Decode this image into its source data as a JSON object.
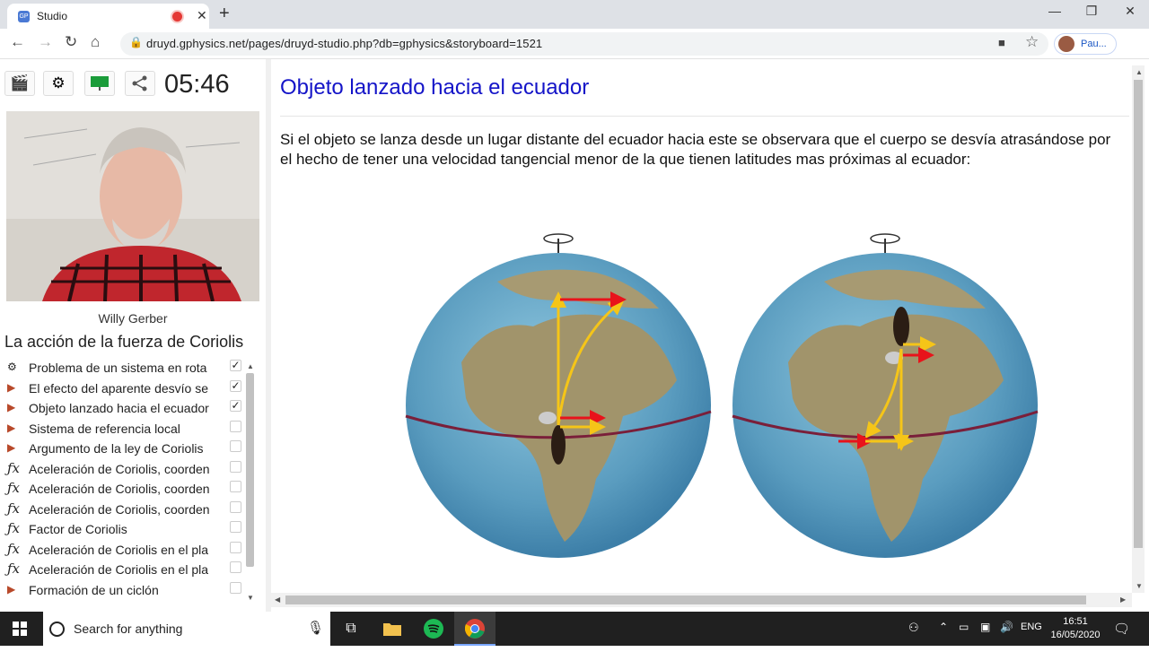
{
  "browser": {
    "tab_title": "Studio",
    "url": "druyd.gphysics.net/pages/druyd-studio.php?db=gphysics&storyboard=1521",
    "profile_name": "Pau..."
  },
  "left": {
    "timer": "05:46",
    "presenter": "Willy Gerber",
    "course_title": "La acción de la fuerza de Coriolis",
    "items": [
      {
        "icon": "film-reel-icon",
        "label": "Problema de un sistema en rota",
        "checked": true
      },
      {
        "icon": "media-icon",
        "label": "El efecto del aparente desvío se",
        "checked": true
      },
      {
        "icon": "media-icon",
        "label": "Objeto lanzado hacia el ecuador",
        "checked": true
      },
      {
        "icon": "media-icon",
        "label": "Sistema de referencia local",
        "checked": false
      },
      {
        "icon": "media-icon",
        "label": "Argumento de la ley de Coriolis",
        "checked": false
      },
      {
        "icon": "fx-icon",
        "label": "Aceleración de Coriolis, coorden",
        "checked": false
      },
      {
        "icon": "fx-icon",
        "label": "Aceleración de Coriolis, coorden",
        "checked": false
      },
      {
        "icon": "fx-icon",
        "label": "Aceleración de Coriolis, coorden",
        "checked": false
      },
      {
        "icon": "fx-icon",
        "label": "Factor de Coriolis",
        "checked": false
      },
      {
        "icon": "fx-icon",
        "label": "Aceleración de Coriolis en el pla",
        "checked": false
      },
      {
        "icon": "fx-icon",
        "label": "Aceleración de Coriolis en el pla",
        "checked": false
      },
      {
        "icon": "media-icon",
        "label": "Formación de un ciclón",
        "checked": false
      }
    ]
  },
  "content": {
    "title": "Objeto lanzado hacia el ecuador",
    "body": "Si el objeto se lanza desde un lugar distante del ecuador hacia este se observara que el cuerpo se desvía atrasándose por el hecho de tener una velocidad tangencial menor de la que tienen latitudes mas próximas al ecuador:"
  },
  "taskbar": {
    "search_placeholder": "Search for anything",
    "language": "ENG",
    "time": "16:51",
    "date": "16/05/2020"
  },
  "colors": {
    "title_blue": "#1414c8",
    "arrow_yellow": "#f5c518",
    "arrow_red": "#e8131b",
    "equator": "#7a1f3a"
  }
}
